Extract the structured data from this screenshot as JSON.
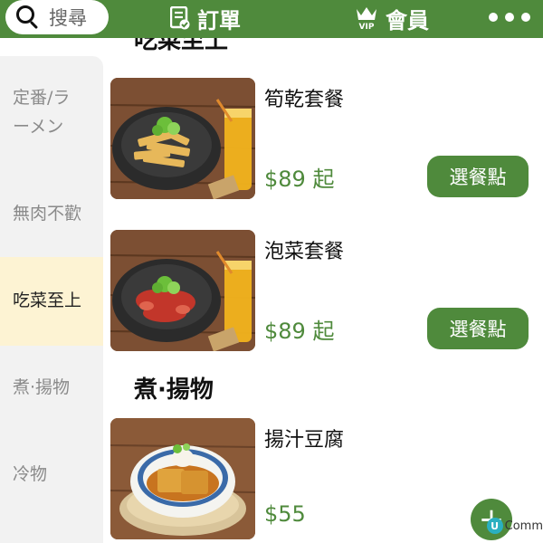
{
  "header": {
    "search_label": "搜尋",
    "orders_label": "訂單",
    "member_label": "會員",
    "vip_badge": "VIP",
    "icons": {
      "search": "search-icon",
      "orders": "order-sheet-icon",
      "member": "vip-crown-icon",
      "more": "more-dots-icon"
    }
  },
  "sidebar": {
    "items": [
      {
        "label_line1": "定番/ラ",
        "label_line2": "ーメン",
        "active": false
      },
      {
        "label_line1": "無肉不歡",
        "active": false
      },
      {
        "label_line1": "吃菜至上",
        "active": true
      },
      {
        "label_line1": "煮·揚物",
        "active": false
      },
      {
        "label_line1": "冷物",
        "active": false
      }
    ]
  },
  "main": {
    "sections": [
      {
        "title": "吃菜至上",
        "items": [
          {
            "name": "筍乾套餐",
            "price": "$89 起",
            "button": "選餐點"
          },
          {
            "name": "泡菜套餐",
            "price": "$89 起",
            "button": "選餐點"
          }
        ]
      },
      {
        "title": "煮·揚物",
        "items": [
          {
            "name": "揚汁豆腐",
            "price": "$55"
          }
        ]
      }
    ],
    "add_button": "+",
    "watermark_letter": "U",
    "watermark_text": "Comm"
  },
  "colors": {
    "brand_green": "#4f8a3c",
    "active_bg": "#fdf3d3",
    "sidebar_bg": "#f2f2f2"
  }
}
